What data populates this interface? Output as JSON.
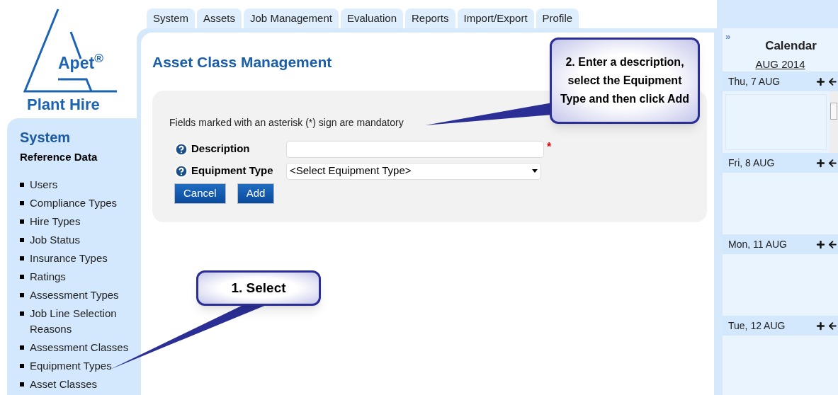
{
  "logo": {
    "brand": "Apet$^{®}$",
    "subtitle": "Plant Hire"
  },
  "tabs": [
    {
      "label": "System"
    },
    {
      "label": "Assets"
    },
    {
      "label": "Job Management"
    },
    {
      "label": "Evaluation"
    },
    {
      "label": "Reports"
    },
    {
      "label": "Import/Export"
    },
    {
      "label": "Profile"
    }
  ],
  "sidebar": {
    "title": "System",
    "section": "Reference Data",
    "items": [
      "Users",
      "Compliance Types",
      "Hire Types",
      "Job Status",
      "Insurance Types",
      "Ratings",
      "Assessment Types",
      "Job Line Selection Reasons",
      "Assessment Classes",
      "Equipment Types",
      "Asset Classes"
    ]
  },
  "page": {
    "title": "Asset Class Management",
    "note": "Fields marked with an asterisk (*) sign are mandatory",
    "fields": [
      {
        "kind": "text",
        "label": "Description",
        "required_mark": "*"
      },
      {
        "kind": "select",
        "label": "Equipment Type",
        "value": "<Select Equipment Type>"
      }
    ],
    "buttons": [
      "Cancel",
      "Add"
    ]
  },
  "calendar": {
    "collapse": "»",
    "title": "Calendar",
    "month": "AUG 2014",
    "days": [
      {
        "label": "Thu, 7 AUG",
        "kind": "scrolling"
      },
      {
        "label": "Fri, 8 AUG",
        "kind": "empty"
      },
      {
        "label": "Mon, 11 AUG",
        "kind": "empty"
      },
      {
        "label": "Tue, 12 AUG",
        "kind": "empty"
      }
    ]
  },
  "callouts": [
    {
      "text": "1. Select"
    },
    {
      "text": "2. Enter a description, select the Equipment Type and then click Add"
    }
  ]
}
